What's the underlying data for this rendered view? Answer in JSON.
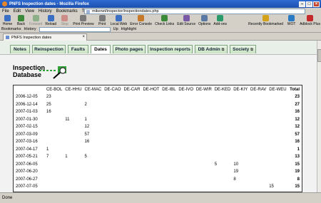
{
  "window": {
    "title": "PNFS Inspection dates - Mozilla Firefox"
  },
  "menu": [
    "File",
    "Edit",
    "View",
    "History",
    "Bookmarks",
    "Tools",
    "Help"
  ],
  "address": {
    "url": "mikenet/inspector/inspectiondates.php"
  },
  "toolbar": [
    {
      "label": "Home",
      "icon": "home-icon",
      "disabled": false
    },
    {
      "label": "Back",
      "icon": "back-icon",
      "disabled": false
    },
    {
      "label": "Forward",
      "icon": "forward-icon",
      "disabled": true
    },
    {
      "label": "Reload",
      "icon": "reload-icon",
      "disabled": false
    },
    {
      "label": "Stop",
      "icon": "stop-icon",
      "disabled": true
    },
    {
      "label": "Print Preview",
      "icon": "print-preview-icon",
      "disabled": false
    },
    {
      "label": "Print",
      "icon": "print-icon",
      "disabled": false
    },
    {
      "label": "Local Web",
      "icon": "local-web-icon",
      "disabled": false
    },
    {
      "label": "Error Console",
      "icon": "error-console-icon",
      "disabled": false
    },
    {
      "label": "Check Links",
      "icon": "check-links-icon",
      "disabled": false
    },
    {
      "label": "Edit Source",
      "icon": "edit-source-icon",
      "disabled": false
    },
    {
      "label": "Options",
      "icon": "options-icon",
      "disabled": false
    },
    {
      "label": "Add-ons",
      "icon": "addons-icon",
      "disabled": false
    },
    {
      "label": "Recently Bookmarked",
      "icon": "recently-bookmarked-icon",
      "disabled": false
    },
    {
      "label": "WOT",
      "icon": "wot-icon",
      "disabled": false
    },
    {
      "label": "Adblock Plus",
      "icon": "adblock-icon",
      "disabled": false
    }
  ],
  "bookmarks_bar": {
    "bookmarks": "Bookmarks",
    "history": "History",
    "up": "Up",
    "highlight": "Highlight"
  },
  "browser_tab": {
    "title": "PNFS Inspection dates"
  },
  "nav_tabs": [
    {
      "label": "Notes",
      "external": false
    },
    {
      "label": "Reinspection",
      "external": false
    },
    {
      "label": "Faults",
      "external": false
    },
    {
      "label": "Dates",
      "external": false,
      "active": true
    },
    {
      "label": "Photo pages",
      "external": false
    },
    {
      "label": "Inspection reports",
      "external": false
    },
    {
      "label": "DB Admin",
      "external": true
    },
    {
      "label": "Society",
      "external": true
    }
  ],
  "logo": {
    "line1": "Inspection",
    "line2": "Database"
  },
  "table": {
    "headers": [
      "",
      "CE-BOL",
      "CE-HHU",
      "CE-MAC",
      "DE-CAO",
      "DE-CAR",
      "DE-HOT",
      "DE-IBL",
      "DE-IVO",
      "DE-WIR",
      "DE-KED",
      "DE-KIY",
      "DE-RAV",
      "DE-WEU",
      "Total"
    ],
    "rows": [
      [
        "2006-12-05",
        "23",
        "",
        "",
        "",
        "",
        "",
        "",
        "",
        "",
        "",
        "",
        "",
        "",
        "23"
      ],
      [
        "2006-12-14",
        "25",
        "",
        "2",
        "",
        "",
        "",
        "",
        "",
        "",
        "",
        "",
        "",
        "",
        "27"
      ],
      [
        "2007-01-03",
        "16",
        "",
        "",
        "",
        "",
        "",
        "",
        "",
        "",
        "",
        "",
        "",
        "",
        "16"
      ],
      [
        "2007-01-30",
        "",
        "11",
        "1",
        "",
        "",
        "",
        "",
        "",
        "",
        "",
        "",
        "",
        "",
        "12"
      ],
      [
        "2007-02-15",
        "",
        "",
        "12",
        "",
        "",
        "",
        "",
        "",
        "",
        "",
        "",
        "",
        "",
        "12"
      ],
      [
        "2007-03-09",
        "",
        "",
        "57",
        "",
        "",
        "",
        "",
        "",
        "",
        "",
        "",
        "",
        "",
        "57"
      ],
      [
        "2007-03-16",
        "",
        "",
        "16",
        "",
        "",
        "",
        "",
        "",
        "",
        "",
        "",
        "",
        "",
        "16"
      ],
      [
        "2007-04-17",
        "1",
        "",
        "",
        "",
        "",
        "",
        "",
        "",
        "",
        "",
        "",
        "",
        "",
        "1"
      ],
      [
        "2007-05-21",
        "7",
        "1",
        "5",
        "",
        "",
        "",
        "",
        "",
        "",
        "",
        "",
        "",
        "",
        "13"
      ],
      [
        "2007-06-05",
        "",
        "",
        "",
        "",
        "",
        "",
        "",
        "",
        "",
        "5",
        "10",
        "",
        "",
        "15"
      ],
      [
        "2007-06-20",
        "",
        "",
        "",
        "",
        "",
        "",
        "",
        "",
        "",
        "",
        "19",
        "",
        "",
        "19"
      ],
      [
        "2007-06-27",
        "",
        "",
        "",
        "",
        "",
        "",
        "",
        "",
        "",
        "",
        "8",
        "",
        "",
        "8"
      ],
      [
        "2007-07-05",
        "",
        "",
        "",
        "",
        "",
        "",
        "",
        "",
        "",
        "",
        "",
        "",
        "15",
        "15"
      ],
      [
        "2007-08-09",
        "",
        "",
        "",
        "",
        "",
        "",
        "",
        "",
        "",
        "",
        "",
        "",
        "12",
        "12"
      ]
    ]
  },
  "status": {
    "text": "Done"
  }
}
